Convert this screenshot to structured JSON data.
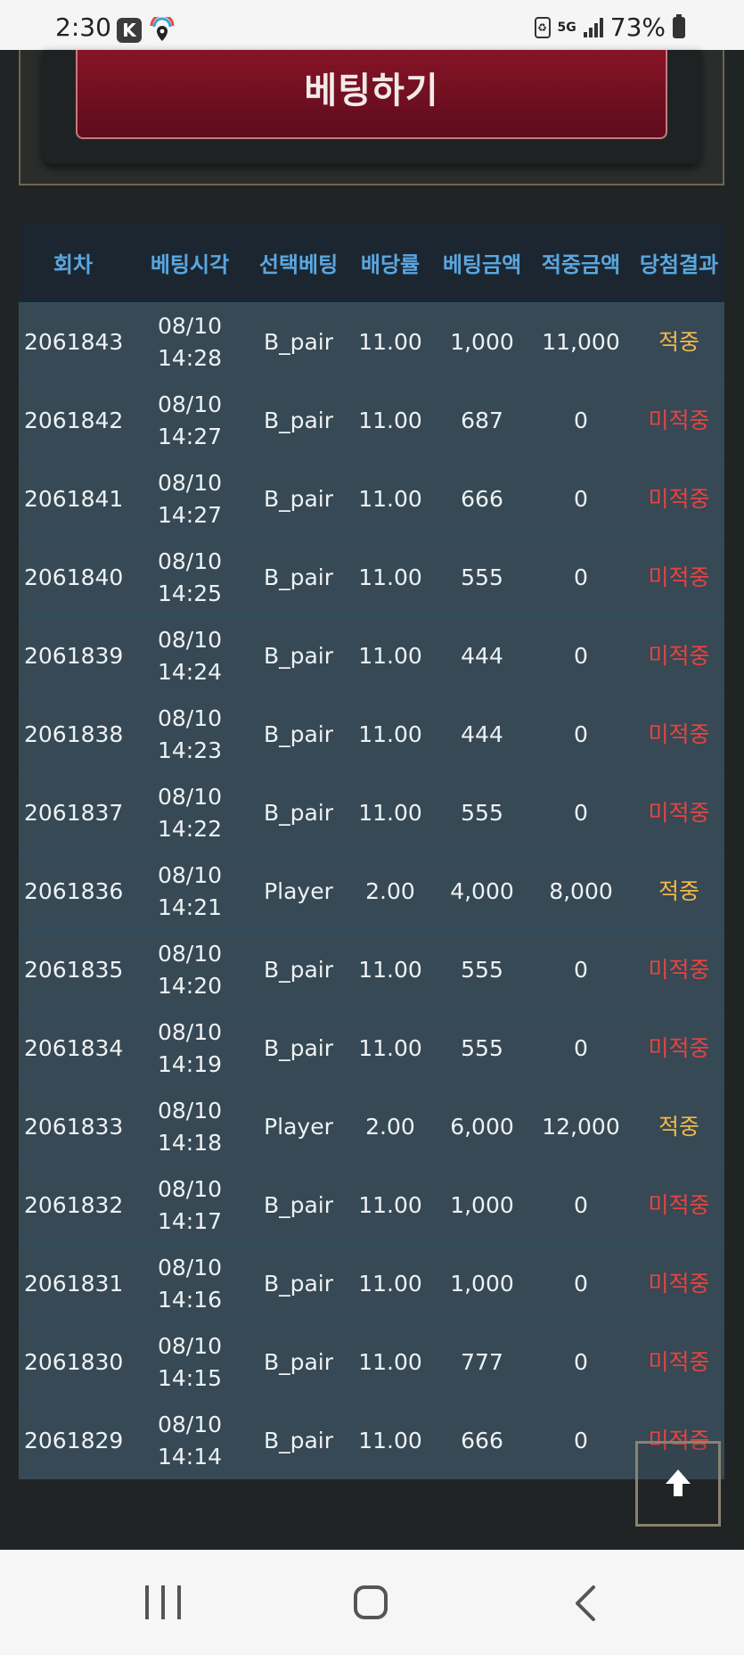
{
  "status_bar": {
    "time": "2:30",
    "k_app_label": "K",
    "network": "5G",
    "battery": "73%"
  },
  "bet_button": {
    "label": "베팅하기"
  },
  "table": {
    "headers": [
      "회차",
      "베팅시각",
      "선택베팅",
      "배당률",
      "베팅금액",
      "적중금액",
      "당첨결과"
    ],
    "rows": [
      {
        "round": "2061843",
        "date": "08/10",
        "time": "14:28",
        "pick": "B_pair",
        "odds": "11.00",
        "amount": "1,000",
        "win": "11,000",
        "result": "적중",
        "status": "hit"
      },
      {
        "round": "2061842",
        "date": "08/10",
        "time": "14:27",
        "pick": "B_pair",
        "odds": "11.00",
        "amount": "687",
        "win": "0",
        "result": "미적중",
        "status": "miss"
      },
      {
        "round": "2061841",
        "date": "08/10",
        "time": "14:27",
        "pick": "B_pair",
        "odds": "11.00",
        "amount": "666",
        "win": "0",
        "result": "미적중",
        "status": "miss"
      },
      {
        "round": "2061840",
        "date": "08/10",
        "time": "14:25",
        "pick": "B_pair",
        "odds": "11.00",
        "amount": "555",
        "win": "0",
        "result": "미적중",
        "status": "miss"
      },
      {
        "round": "2061839",
        "date": "08/10",
        "time": "14:24",
        "pick": "B_pair",
        "odds": "11.00",
        "amount": "444",
        "win": "0",
        "result": "미적중",
        "status": "miss"
      },
      {
        "round": "2061838",
        "date": "08/10",
        "time": "14:23",
        "pick": "B_pair",
        "odds": "11.00",
        "amount": "444",
        "win": "0",
        "result": "미적중",
        "status": "miss"
      },
      {
        "round": "2061837",
        "date": "08/10",
        "time": "14:22",
        "pick": "B_pair",
        "odds": "11.00",
        "amount": "555",
        "win": "0",
        "result": "미적중",
        "status": "miss"
      },
      {
        "round": "2061836",
        "date": "08/10",
        "time": "14:21",
        "pick": "Player",
        "odds": "2.00",
        "amount": "4,000",
        "win": "8,000",
        "result": "적중",
        "status": "hit"
      },
      {
        "round": "2061835",
        "date": "08/10",
        "time": "14:20",
        "pick": "B_pair",
        "odds": "11.00",
        "amount": "555",
        "win": "0",
        "result": "미적중",
        "status": "miss"
      },
      {
        "round": "2061834",
        "date": "08/10",
        "time": "14:19",
        "pick": "B_pair",
        "odds": "11.00",
        "amount": "555",
        "win": "0",
        "result": "미적중",
        "status": "miss"
      },
      {
        "round": "2061833",
        "date": "08/10",
        "time": "14:18",
        "pick": "Player",
        "odds": "2.00",
        "amount": "6,000",
        "win": "12,000",
        "result": "적중",
        "status": "hit"
      },
      {
        "round": "2061832",
        "date": "08/10",
        "time": "14:17",
        "pick": "B_pair",
        "odds": "11.00",
        "amount": "1,000",
        "win": "0",
        "result": "미적중",
        "status": "miss"
      },
      {
        "round": "2061831",
        "date": "08/10",
        "time": "14:16",
        "pick": "B_pair",
        "odds": "11.00",
        "amount": "1,000",
        "win": "0",
        "result": "미적중",
        "status": "miss"
      },
      {
        "round": "2061830",
        "date": "08/10",
        "time": "14:15",
        "pick": "B_pair",
        "odds": "11.00",
        "amount": "777",
        "win": "0",
        "result": "미적중",
        "status": "miss"
      },
      {
        "round": "2061829",
        "date": "08/10",
        "time": "14:14",
        "pick": "B_pair",
        "odds": "11.00",
        "amount": "666",
        "win": "0",
        "result": "미적중",
        "status": "miss"
      }
    ]
  },
  "colors": {
    "hit": "#f2b84a",
    "miss": "#e8433f",
    "header_text": "#5aa7df",
    "row_bg": "#364955",
    "button_bg": "#7a1022"
  },
  "icons": {
    "scroll_top": "arrow-up-icon",
    "nav_recent": "recent-apps-icon",
    "nav_home": "home-icon",
    "nav_back": "back-icon"
  }
}
